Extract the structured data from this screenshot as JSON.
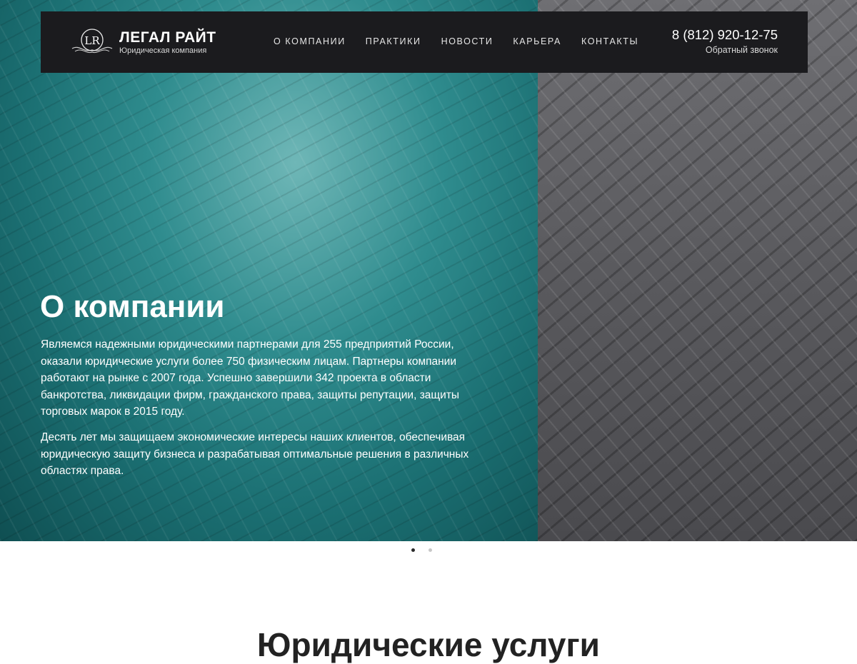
{
  "header": {
    "logo_name": "ЛЕГАЛ РАЙТ",
    "logo_subtitle": "Юридическая компания",
    "logo_monogram": "LR",
    "menu": [
      {
        "label": "О КОМПАНИИ"
      },
      {
        "label": "ПРАКТИКИ"
      },
      {
        "label": "НОВОСТИ"
      },
      {
        "label": "КАРЬЕРА"
      },
      {
        "label": "КОНТАКТЫ"
      }
    ],
    "phone": "8 (812) 920-12-75",
    "callback": "Обратный звонок"
  },
  "hero": {
    "title": "О компании",
    "paragraph1": "Являемся надежными юридическими партнерами для 255 предприятий России, оказали юридические услуги более 750 физическим лицам. Партнеры компании работают на рынке с 2007 года. Успешно завершили 342 проекта в области банкротства, ликвидации фирм, гражданского права, защиты репутации, защиты торговых марок в 2015 году.",
    "paragraph2": "Десять лет мы защищаем экономические интересы наших клиентов, обеспечивая юридическую защиту бизнеса и разрабатывая оптимальные решения в различных областях права.",
    "slider_count": 2,
    "slider_active": 1
  },
  "services": {
    "title": "Юридические услуги"
  },
  "colors": {
    "navbar": "#1b1b1e",
    "teal": "#2f8c8e",
    "gray": "#5a5a5e"
  }
}
